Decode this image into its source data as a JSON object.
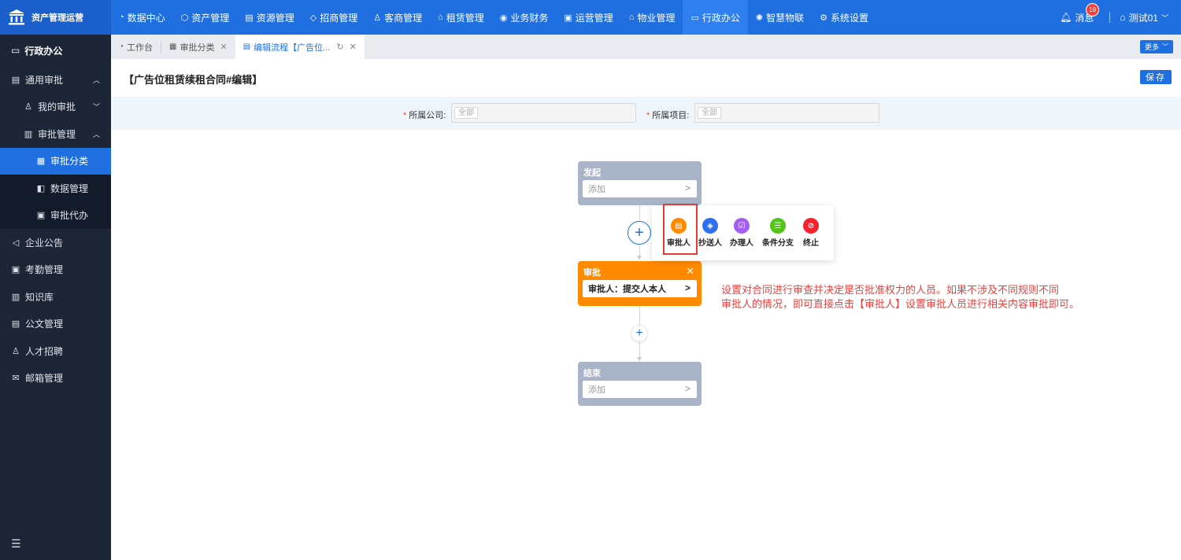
{
  "app": {
    "name": "资产管理运营"
  },
  "nav": [
    {
      "icon": "◔",
      "label": "数据中心"
    },
    {
      "icon": "⬡",
      "label": "资产管理"
    },
    {
      "icon": "▤",
      "label": "资源管理"
    },
    {
      "icon": "◇",
      "label": "招商管理"
    },
    {
      "icon": "♙",
      "label": "客商管理"
    },
    {
      "icon": "⌂",
      "label": "租赁管理"
    },
    {
      "icon": "◉",
      "label": "业务财务"
    },
    {
      "icon": "▣",
      "label": "运营管理"
    },
    {
      "icon": "⌂",
      "label": "物业管理"
    },
    {
      "icon": "▭",
      "label": "行政办公"
    },
    {
      "icon": "✺",
      "label": "智慧物联"
    },
    {
      "icon": "⚙",
      "label": "系统设置"
    }
  ],
  "header": {
    "messages_label": "消息",
    "messages_count": "19",
    "user_name": "测试01"
  },
  "sidebar": {
    "title": "行政办公",
    "items": [
      {
        "label": "通用审批",
        "level": 1
      },
      {
        "label": "我的审批",
        "level": 2
      },
      {
        "label": "审批管理",
        "level": 2
      },
      {
        "label": "审批分类",
        "level": 3
      },
      {
        "label": "数据管理",
        "level": 3
      },
      {
        "label": "审批代办",
        "level": 3
      },
      {
        "label": "企业公告",
        "level": 1
      },
      {
        "label": "考勤管理",
        "level": 1
      },
      {
        "label": "知识库",
        "level": 1
      },
      {
        "label": "公文管理",
        "level": 1
      },
      {
        "label": "人才招聘",
        "level": 1
      },
      {
        "label": "邮箱管理",
        "level": 1
      }
    ]
  },
  "tabs": [
    {
      "label": "工作台"
    },
    {
      "label": "审批分类"
    },
    {
      "label": "编辑流程【广告位..."
    }
  ],
  "tabs_more": "更多",
  "page": {
    "title": "【广告位租赁续租合同#编辑】",
    "save_label": "保存"
  },
  "filters": {
    "company_label": "所属公司:",
    "company_value": "全部",
    "project_label": "所属项目:",
    "project_value": "全部"
  },
  "flow": {
    "start": {
      "title": "发起",
      "body": "添加"
    },
    "approve": {
      "title": "审批",
      "body": "审批人：提交人本人"
    },
    "end": {
      "title": "结束",
      "body": "添加"
    }
  },
  "popup_options": [
    {
      "label": "审批人",
      "color": "#ff8a00"
    },
    {
      "label": "抄送人",
      "color": "#2f6ff0"
    },
    {
      "label": "办理人",
      "color": "#a35df0"
    },
    {
      "label": "条件分支",
      "color": "#52c41a"
    },
    {
      "label": "终止",
      "color": "#f5222d"
    }
  ],
  "annotation": {
    "line1": "设置对合同进行审查并决定是否批准权力的人员。如果不涉及不同规则不同",
    "line2": "审批人的情况，即可直接点击【审批人】设置审批人员进行相关内容审批即可。"
  }
}
